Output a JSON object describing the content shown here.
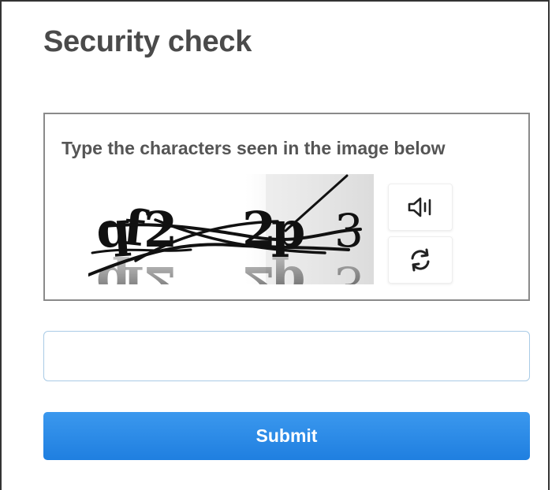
{
  "page": {
    "title": "Security check"
  },
  "captcha": {
    "instruction": "Type the characters seen in the image below",
    "image_text": "qf2 2p 3",
    "audio_icon": "speaker-icon",
    "refresh_icon": "refresh-icon"
  },
  "form": {
    "input_value": "",
    "input_placeholder": "",
    "submit_label": "Submit"
  },
  "colors": {
    "title": "#4a4a4a",
    "instruction": "#555555",
    "box_border": "#8a8a8a",
    "input_border": "#a9cbe6",
    "submit_bg": "#2a8be8",
    "submit_text": "#ffffff"
  }
}
